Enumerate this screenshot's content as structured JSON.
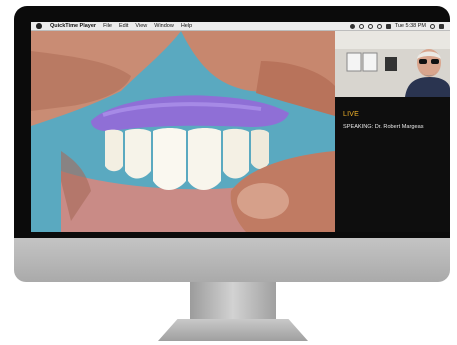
{
  "menubar": {
    "app_name": "QuickTime Player",
    "items": [
      "File",
      "Edit",
      "View",
      "Window",
      "Help"
    ],
    "clock": "Tue 5:38 PM"
  },
  "stream": {
    "status": "LIVE",
    "speaker": "SPEAKING: Dr. Robert Margeas"
  },
  "colors": {
    "live_accent": "#f0b22a",
    "impression_material": "#8f6fd6"
  }
}
